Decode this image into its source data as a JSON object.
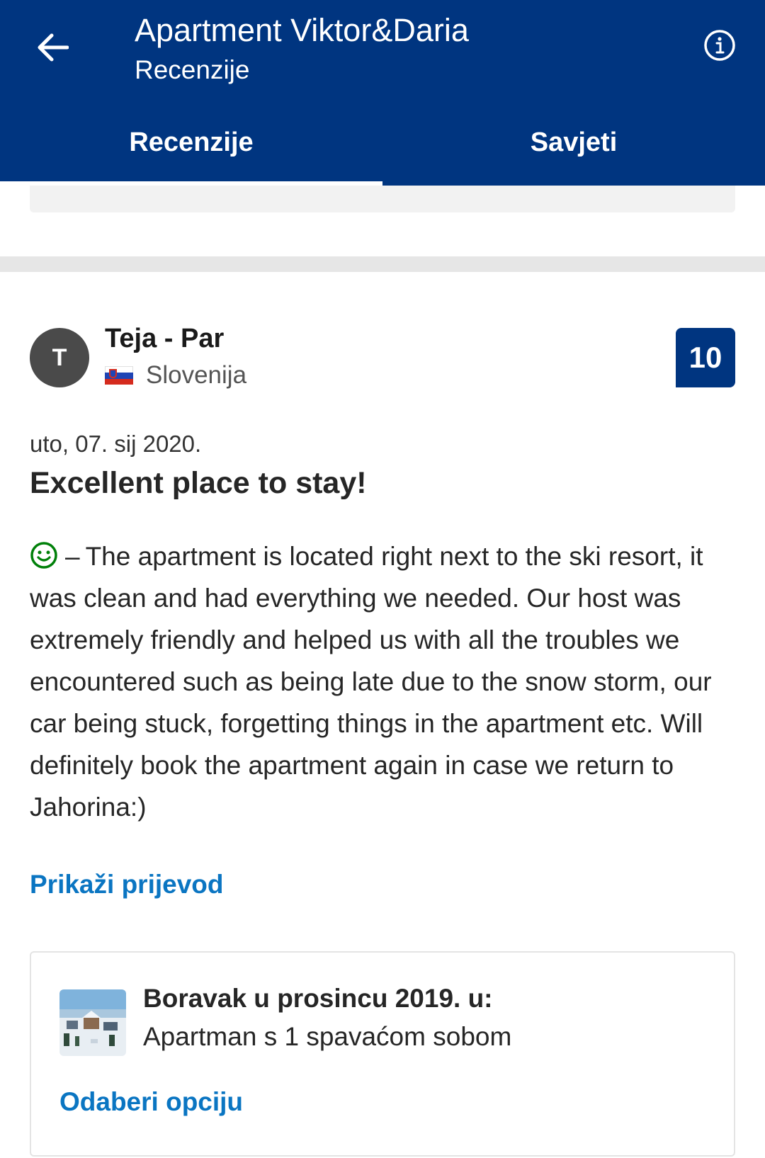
{
  "header": {
    "title": "Apartment Viktor&Daria",
    "subtitle": "Recenzije",
    "back_icon": "arrow-left-icon",
    "info_icon": "info-circle-icon",
    "background_color": "#003580"
  },
  "tabs": [
    {
      "label": "Recenzije",
      "active": true
    },
    {
      "label": "Savjeti",
      "active": false
    }
  ],
  "review": {
    "avatar_initial": "T",
    "reviewer_name": "Teja - Par",
    "country": "Slovenija",
    "country_flag_icon": "slovenia-flag-icon",
    "score": "10",
    "date": "uto, 07. sij 2020.",
    "title": "Excellent place to stay!",
    "positive_icon": "smiley-icon",
    "positive_dash": "–",
    "positive_text": "The apartment is located right next to the ski resort, it was clean and had everything we needed. Our host was extremely friendly and helped us with all the troubles we encountered such as being late due to the snow storm, our car being stuck, forgetting things in the apartment etc. Will definitely book the apartment again in case we return to Jahorina:)",
    "translate_label": "Prikaži prijevod"
  },
  "stay": {
    "heading": "Boravak u prosincu 2019. u:",
    "room": "Apartman s 1 spavaćom sobom",
    "choose_label": "Odaberi opciju"
  },
  "colors": {
    "brand_blue": "#003580",
    "link_blue": "#0a75c2",
    "positive_green": "#008009"
  }
}
